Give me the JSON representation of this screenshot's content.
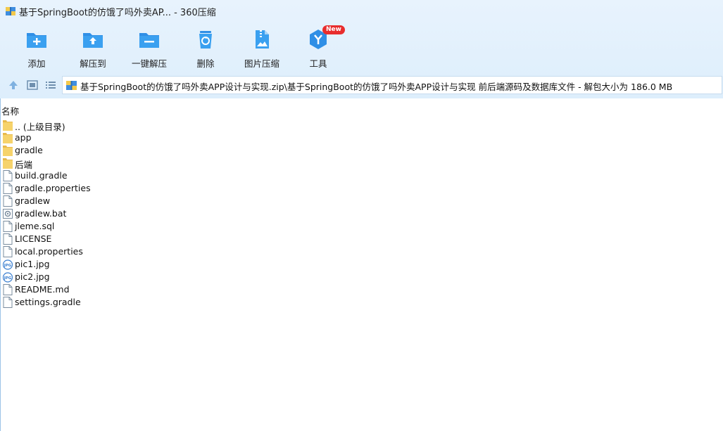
{
  "window": {
    "title": "基于SpringBoot的仿饿了吗外卖AP... - 360压缩"
  },
  "toolbar": {
    "buttons": [
      {
        "label": "添加",
        "icon": "add-folder-icon"
      },
      {
        "label": "解压到",
        "icon": "extract-to-icon"
      },
      {
        "label": "一键解压",
        "icon": "one-click-extract-icon"
      },
      {
        "label": "删除",
        "icon": "delete-icon"
      },
      {
        "label": "图片压缩",
        "icon": "image-compress-icon"
      },
      {
        "label": "工具",
        "icon": "tools-icon",
        "badge": "New"
      }
    ]
  },
  "navbar": {
    "path": "基于SpringBoot的仿饿了吗外卖APP设计与实现.zip\\基于SpringBoot的仿饿了吗外卖APP设计与实现 前后端源码及数据库文件 - 解包大小为 186.0 MB"
  },
  "list": {
    "column_name": "名称",
    "items": [
      {
        "name": ".. (上级目录)",
        "type": "folder"
      },
      {
        "name": "app",
        "type": "folder"
      },
      {
        "name": "gradle",
        "type": "folder"
      },
      {
        "name": "后端",
        "type": "folder"
      },
      {
        "name": "build.gradle",
        "type": "file"
      },
      {
        "name": "gradle.properties",
        "type": "file"
      },
      {
        "name": "gradlew",
        "type": "file"
      },
      {
        "name": "gradlew.bat",
        "type": "bat"
      },
      {
        "name": "jleme.sql",
        "type": "file"
      },
      {
        "name": "LICENSE",
        "type": "file"
      },
      {
        "name": "local.properties",
        "type": "file"
      },
      {
        "name": "pic1.jpg",
        "type": "jpg"
      },
      {
        "name": "pic2.jpg",
        "type": "jpg"
      },
      {
        "name": "README.md",
        "type": "file"
      },
      {
        "name": "settings.gradle",
        "type": "file"
      }
    ]
  },
  "colors": {
    "accent": "#2f8fe6",
    "folder": "#f6d36b",
    "badge": "#e82d2d"
  }
}
